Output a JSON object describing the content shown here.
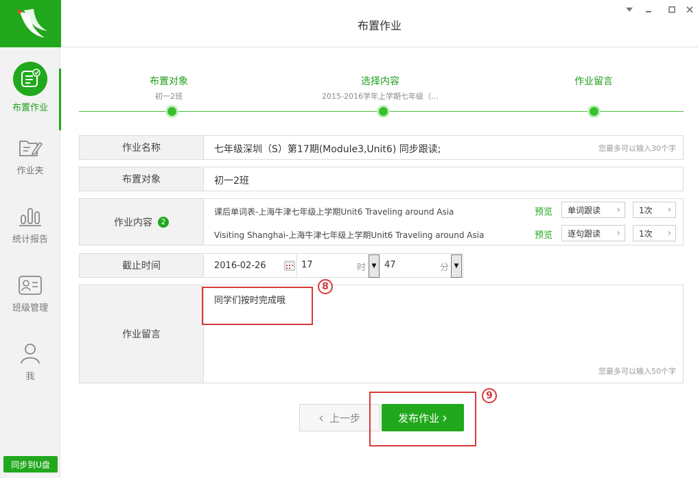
{
  "window": {
    "title": "布置作业",
    "controls": [
      "dropdown-icon",
      "minimize-icon",
      "maximize-icon",
      "close-icon"
    ]
  },
  "sidebar": {
    "items": [
      {
        "label": "布置作业",
        "icon": "assign-homework-icon",
        "active": true
      },
      {
        "label": "作业夹",
        "icon": "folder-edit-icon",
        "active": false
      },
      {
        "label": "统计报告",
        "icon": "bar-chart-icon",
        "active": false
      },
      {
        "label": "班级管理",
        "icon": "class-card-icon",
        "active": false
      },
      {
        "label": "我",
        "icon": "user-icon",
        "active": false
      }
    ],
    "sync_label": "同步到U盘"
  },
  "steps": [
    {
      "title": "布置对象",
      "sub": "初一2班"
    },
    {
      "title": "选择内容",
      "sub": "2015-2016学年上学期七年级（…"
    },
    {
      "title": "作业留言",
      "sub": ""
    }
  ],
  "form": {
    "name": {
      "label": "作业名称",
      "value": "七年级深圳（S）第17期(Module3,Unit6) 同步跟读;",
      "hint": "您最多可以输入30个字"
    },
    "target": {
      "label": "布置对象",
      "value": "初一2班"
    },
    "content": {
      "label": "作业内容",
      "count": "2",
      "items": [
        {
          "text": "课后单词表-上海牛津七年级上学期Unit6 Traveling around Asia",
          "preview": "预览",
          "mode": "单词跟读",
          "times": "1次"
        },
        {
          "text": "Visiting Shanghai-上海牛津七年级上学期Unit6 Traveling around Asia",
          "preview": "预览",
          "mode": "逐句跟读",
          "times": "1次"
        }
      ]
    },
    "deadline": {
      "label": "截止时间",
      "date": "2016-02-26",
      "hour": "17",
      "hour_unit": "时",
      "minute": "47",
      "minute_unit": "分"
    },
    "message": {
      "label": "作业留言",
      "value": "同学们按时完成哦",
      "hint": "您最多可以输入50个字"
    }
  },
  "annotations": {
    "marker8": "8",
    "marker9": "9"
  },
  "buttons": {
    "prev": "上一步",
    "publish": "发布作业"
  },
  "colors": {
    "brand_green": "#21a81c",
    "annotation_red": "#d9383a"
  }
}
